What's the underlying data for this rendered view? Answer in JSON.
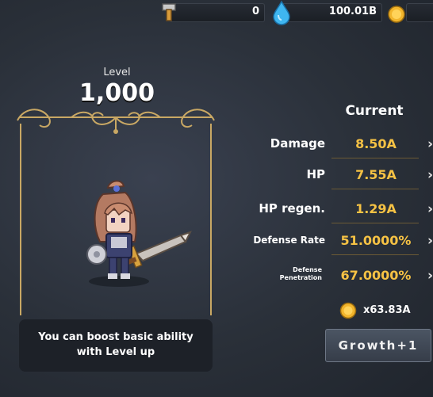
{
  "resources": {
    "hammer_count": "0",
    "gem_count": "100.01B"
  },
  "level": {
    "label": "Level",
    "value": "1,000"
  },
  "hint": {
    "text": "You can boost basic ability with Level up"
  },
  "stats": {
    "header": "Current",
    "rows": [
      {
        "label": "Damage",
        "value": "8.50A"
      },
      {
        "label": "HP",
        "value": "7.55A"
      },
      {
        "label": "HP regen.",
        "value": "1.29A"
      },
      {
        "label": "Defense Rate",
        "value": "51.0000%"
      },
      {
        "label_line1": "Defense",
        "label_line2": "Penetration",
        "value": "67.0000%"
      }
    ],
    "arrow": "›"
  },
  "cost": {
    "value": "x63.83A"
  },
  "growth_button": {
    "label": "Growth+1"
  },
  "colors": {
    "accent_gold": "#f6c244",
    "frame_gold": "#c9a864"
  },
  "icons": [
    "hammer-icon",
    "water-drop-icon",
    "gold-coin-icon",
    "hero-sprite"
  ]
}
